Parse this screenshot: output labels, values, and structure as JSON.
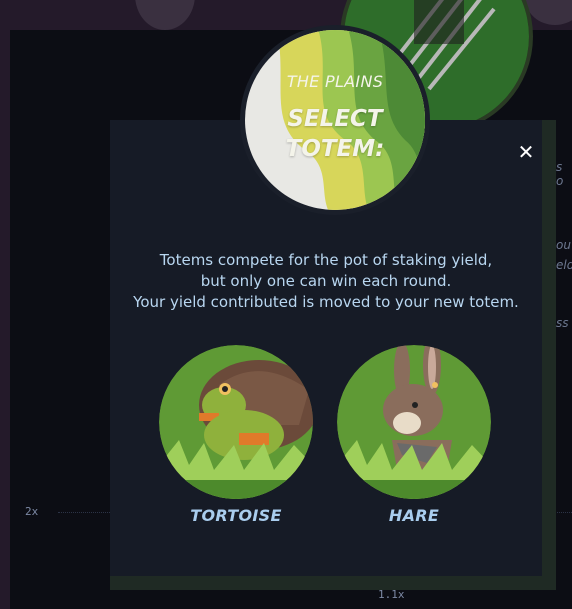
{
  "background": {
    "axis_labels": {
      "left": "2x",
      "bottom": "1.1x"
    },
    "partial_texts": [
      "s o",
      "ou",
      "eld",
      "ss"
    ]
  },
  "modal": {
    "emblem": {
      "kicker": "THE PLAINS",
      "title_line1": "SELECT",
      "title_line2": "TOTEM:"
    },
    "close_glyph": "✕",
    "description": [
      "Totems compete for the pot of staking yield,",
      "but only one can win each round.",
      "Your yield contributed is moved to your new totem."
    ],
    "totems": [
      {
        "label": "TORTOISE",
        "icon": "tortoise-icon"
      },
      {
        "label": "HARE",
        "icon": "hare-icon"
      }
    ]
  },
  "colors": {
    "modal_bg": "#161b26",
    "totem_label": "#a9cdee",
    "description_text": "#b8d6f0",
    "grass_green": "#5f9a35"
  }
}
